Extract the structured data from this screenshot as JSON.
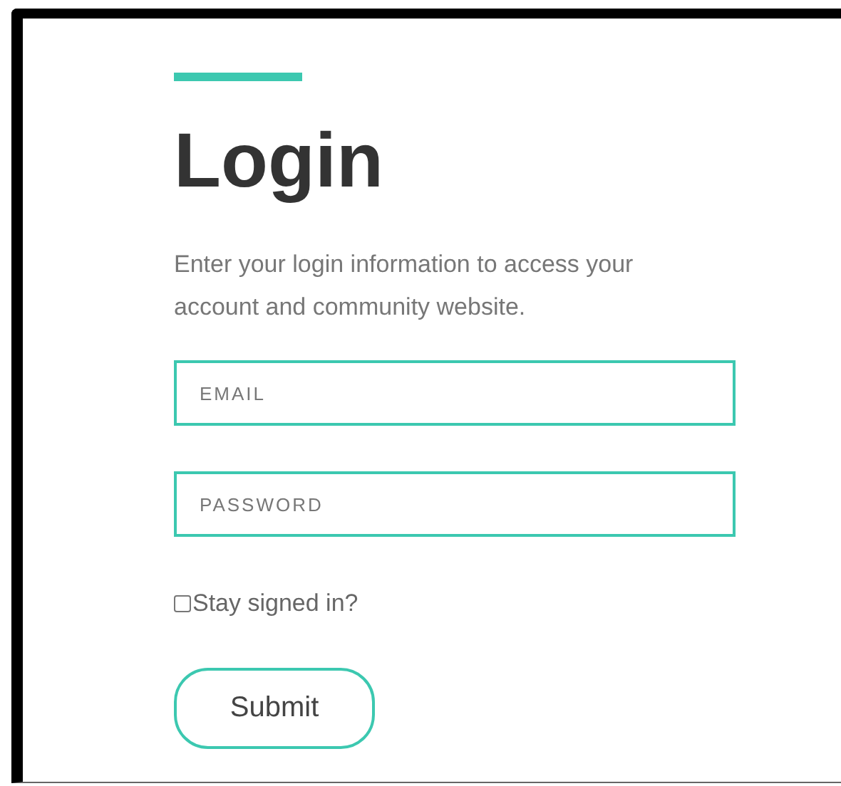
{
  "title": "Login",
  "description": "Enter your login information to access your account and community website.",
  "fields": [
    {
      "placeholder": "EMAIL"
    },
    {
      "placeholder": "PASSWORD"
    }
  ],
  "stay_signed_in": {
    "label": "Stay signed in?",
    "checked": false
  },
  "submit_button": {
    "label": "Submit"
  }
}
